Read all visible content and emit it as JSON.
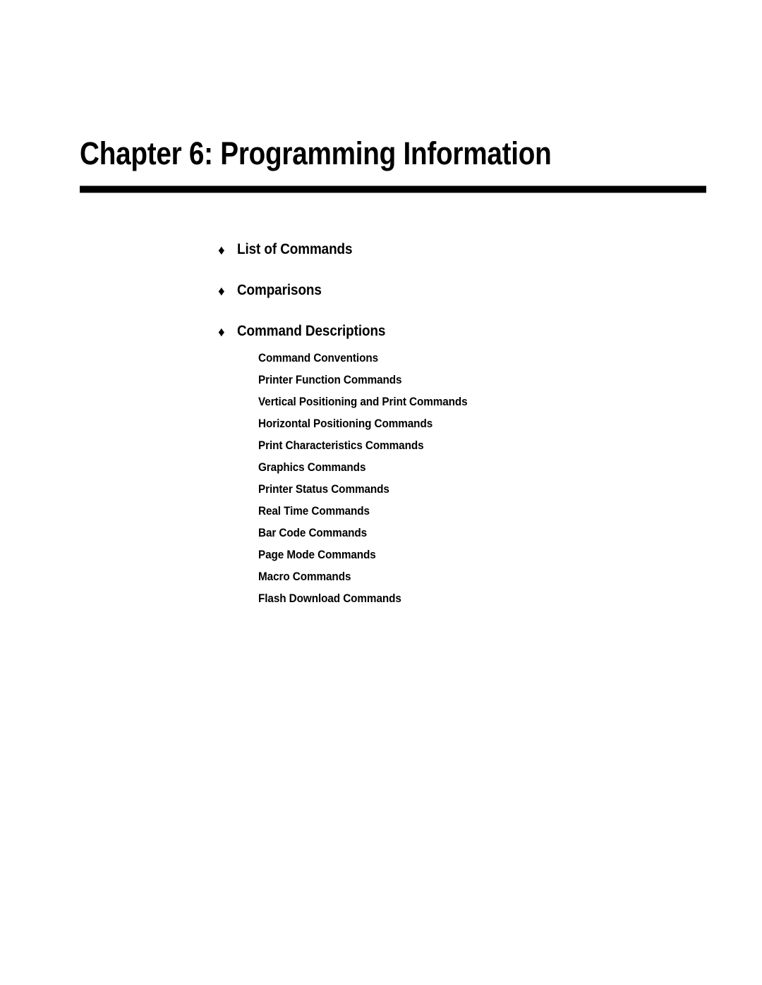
{
  "page": {
    "background_color": "#ffffff",
    "text_color": "#000000"
  },
  "title": {
    "text": "Chapter 6: Programming Information"
  },
  "rule": {
    "color": "#000000"
  },
  "contents": {
    "bullet_glyph": "♦",
    "main_items": [
      {
        "label": "List of Commands"
      },
      {
        "label": "Comparisons"
      },
      {
        "label": "Command Descriptions"
      }
    ],
    "sub_items": [
      {
        "label": "Command Conventions"
      },
      {
        "label": "Printer Function Commands"
      },
      {
        "label": "Vertical Positioning and Print Commands"
      },
      {
        "label": "Horizontal Positioning Commands"
      },
      {
        "label": "Print Characteristics Commands"
      },
      {
        "label": "Graphics Commands"
      },
      {
        "label": "Printer Status Commands"
      },
      {
        "label": "Real Time Commands"
      },
      {
        "label": "Bar Code Commands"
      },
      {
        "label": "Page Mode Commands"
      },
      {
        "label": "Macro Commands"
      },
      {
        "label": "Flash Download Commands"
      }
    ]
  }
}
